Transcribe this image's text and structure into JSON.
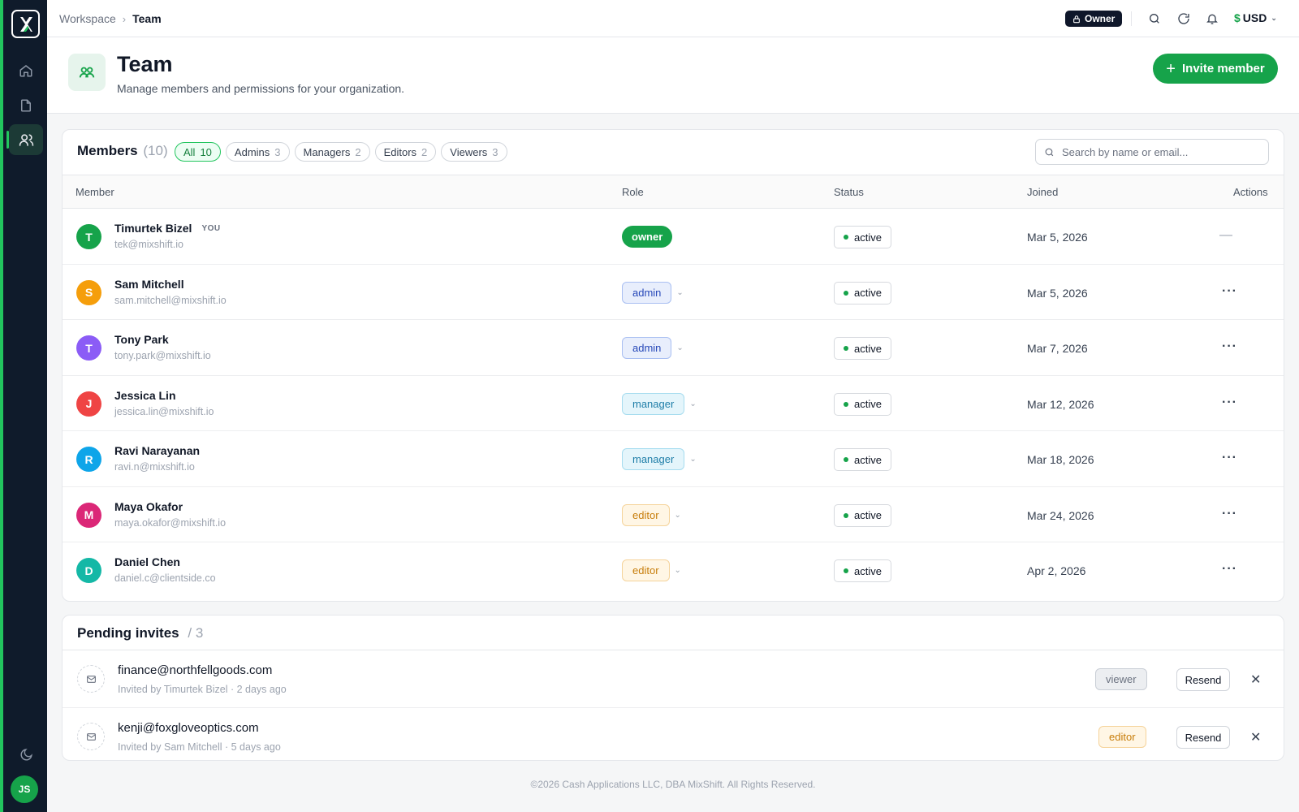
{
  "topbar": {
    "breadcrumb": [
      "Workspace",
      "Team"
    ],
    "role_badge": "Owner",
    "currency_symbol": "$",
    "currency": "USD"
  },
  "header": {
    "title": "Team",
    "subtitle": "Manage members and permissions for your organization.",
    "invite_label": "Invite member"
  },
  "members": {
    "title": "Members",
    "count": "(10)",
    "filters": [
      {
        "label": "All",
        "count": "10",
        "active": true
      },
      {
        "label": "Admins",
        "count": "3"
      },
      {
        "label": "Managers",
        "count": "2"
      },
      {
        "label": "Editors",
        "count": "2"
      },
      {
        "label": "Viewers",
        "count": "3"
      }
    ],
    "search_placeholder": "Search by name or email...",
    "columns": [
      "Member",
      "Role",
      "Status",
      "Joined",
      "Actions"
    ],
    "rows": [
      {
        "initial": "T",
        "avatar_color": "#16a34a",
        "name": "Timurtek Bizel",
        "you": "YOU",
        "email": "tek@mixshift.io",
        "role": "owner",
        "status": "active",
        "joined": "Mar 5, 2026",
        "action": "—"
      },
      {
        "initial": "S",
        "avatar_color": "#f59e0b",
        "name": "Sam Mitchell",
        "email": "sam.mitchell@mixshift.io",
        "role": "admin",
        "status": "active",
        "joined": "Mar 5, 2026",
        "action": "···"
      },
      {
        "initial": "T",
        "avatar_color": "#8b5cf6",
        "name": "Tony Park",
        "email": "tony.park@mixshift.io",
        "role": "admin",
        "status": "active",
        "joined": "Mar 7, 2026",
        "action": "···"
      },
      {
        "initial": "J",
        "avatar_color": "#ef4444",
        "name": "Jessica Lin",
        "email": "jessica.lin@mixshift.io",
        "role": "manager",
        "status": "active",
        "joined": "Mar 12, 2026",
        "action": "···"
      },
      {
        "initial": "R",
        "avatar_color": "#0ea5e9",
        "name": "Ravi Narayanan",
        "email": "ravi.n@mixshift.io",
        "role": "manager",
        "status": "active",
        "joined": "Mar 18, 2026",
        "action": "···"
      },
      {
        "initial": "M",
        "avatar_color": "#db2777",
        "name": "Maya Okafor",
        "email": "maya.okafor@mixshift.io",
        "role": "editor",
        "status": "active",
        "joined": "Mar 24, 2026",
        "action": "···"
      },
      {
        "initial": "D",
        "avatar_color": "#14b8a6",
        "name": "Daniel Chen",
        "email": "daniel.c@clientside.co",
        "role": "editor",
        "status": "active",
        "joined": "Apr 2, 2026",
        "action": "···"
      }
    ]
  },
  "pending": {
    "title": "Pending invites",
    "count": "/ 3",
    "rows": [
      {
        "email": "finance@northfellgoods.com",
        "invited_by": "Invited by Timurtek Bizel · 2 days ago",
        "role": "viewer",
        "resend": "Resend"
      },
      {
        "email": "kenji@foxgloveoptics.com",
        "invited_by": "Invited by Sam Mitchell · 5 days ago",
        "role": "editor",
        "resend": "Resend"
      }
    ]
  },
  "sidebar": {
    "user_initials": "JS"
  },
  "footer": "©2026 Cash Applications LLC, DBA MixShift. All Rights Reserved."
}
